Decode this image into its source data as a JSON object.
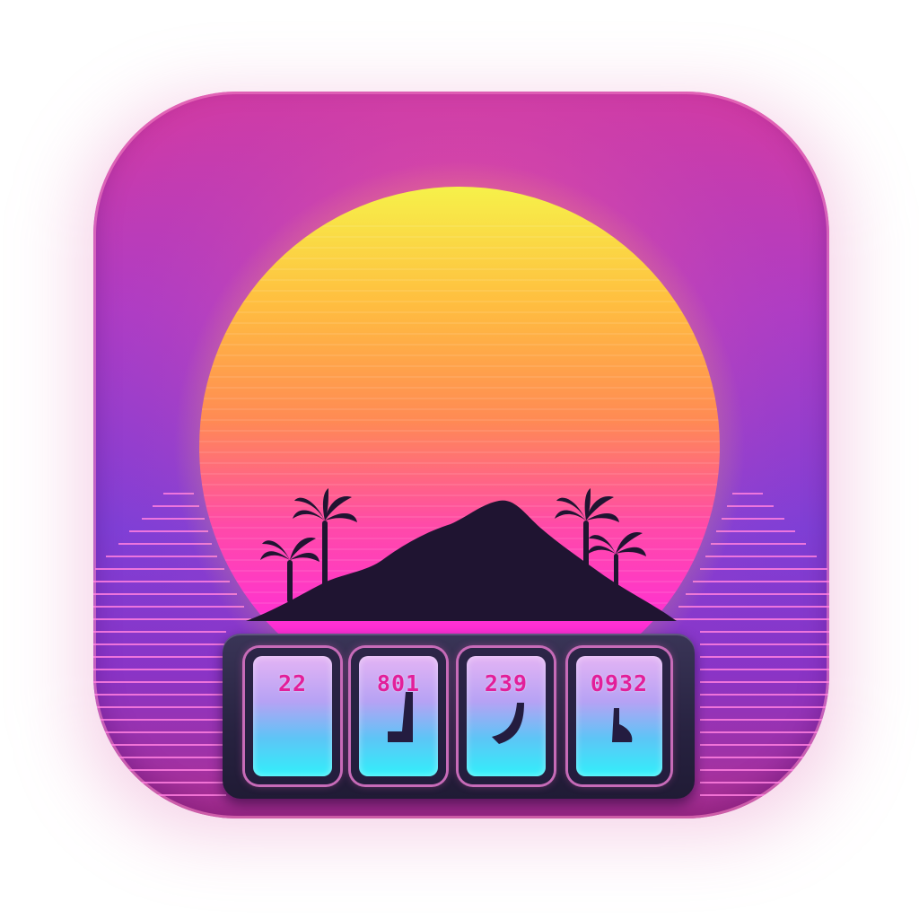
{
  "app_icon": {
    "name": "synthwave-sunset-counter",
    "colors": {
      "sky_top": "#d73aa0",
      "sky_bottom": "#7f3fd6",
      "sun_top": "#f6f14a",
      "sun_mid": "#ff9a4a",
      "sun_bottom": "#ff2fd0",
      "silhouette": "#1f1431",
      "tile_glow": "#31f0fa",
      "digit_color": "#e21f9a"
    },
    "icons": [
      "sun-icon",
      "mountain-icon",
      "palm-tree-icon"
    ],
    "counter_tiles": [
      {
        "digits": "22"
      },
      {
        "digits": "801"
      },
      {
        "digits": "239"
      },
      {
        "digits": "0932"
      }
    ]
  }
}
